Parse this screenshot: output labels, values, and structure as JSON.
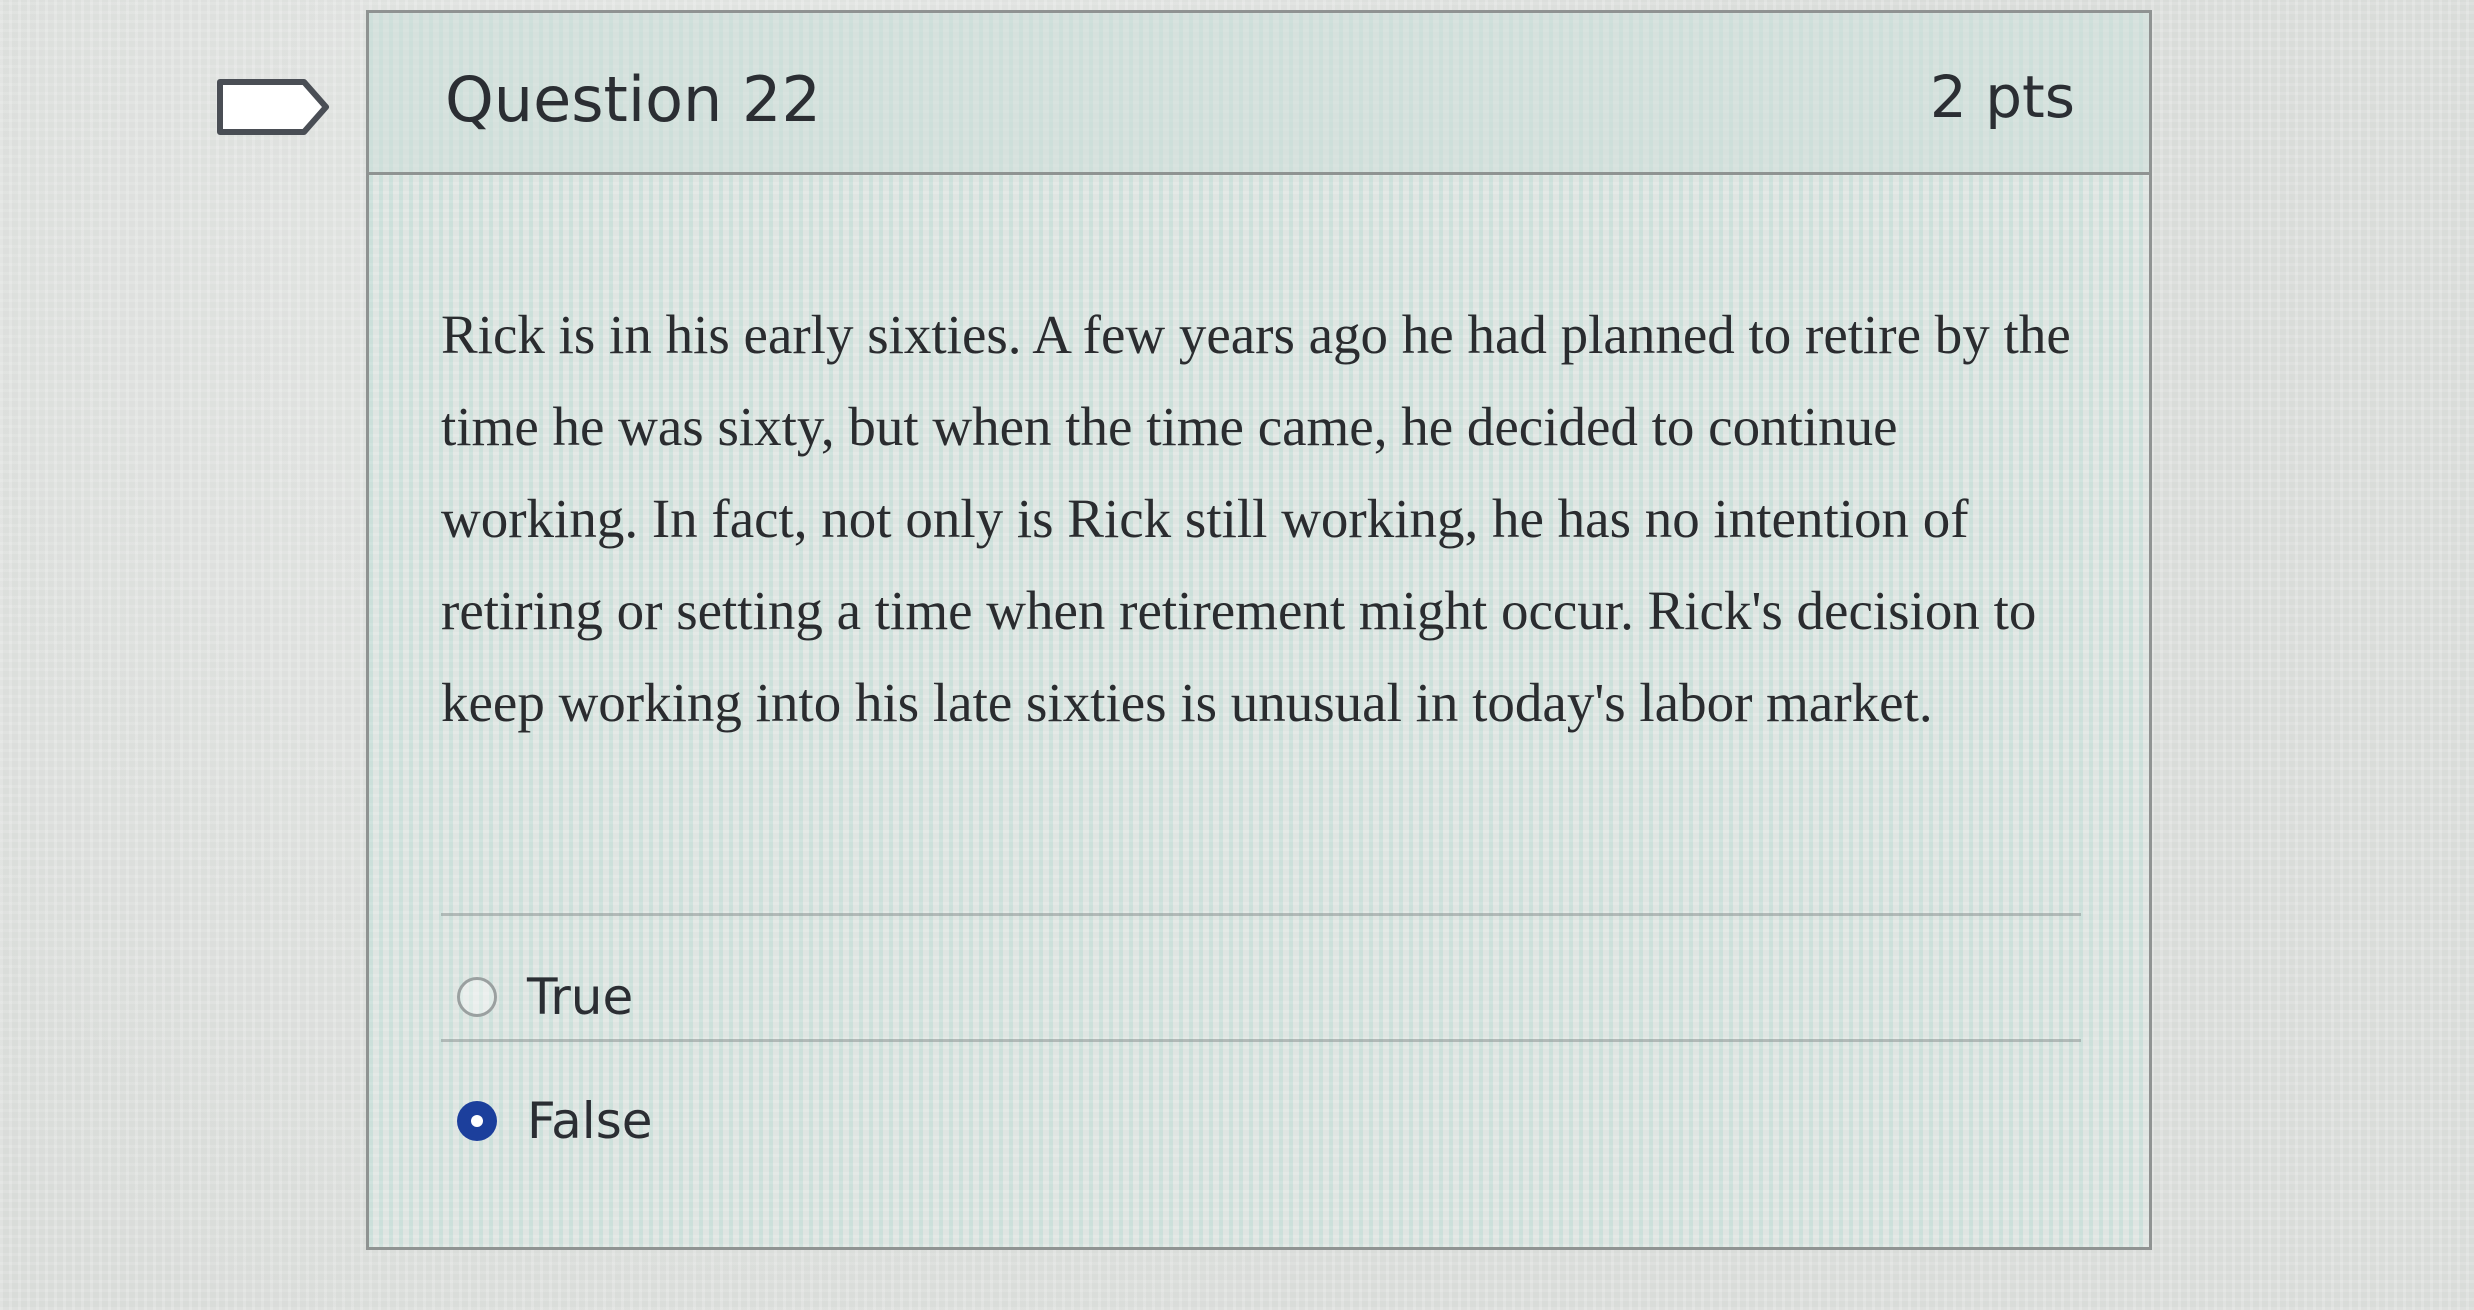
{
  "question": {
    "title": "Question 22",
    "points": "2 pts",
    "flag_icon": "flag-outline-icon",
    "text": "Rick is in his early sixties. A few years ago he had planned to retire by the time he was sixty, but when the time came, he decided to continue working. In fact, not only is Rick still working, he has no intention of retiring or setting a time when retirement might occur. Rick's decision to keep working into his late sixties is unusual in today's labor market."
  },
  "answers": [
    {
      "label": "True",
      "selected": false
    },
    {
      "label": "False",
      "selected": true
    }
  ],
  "colors": {
    "selected_radio": "#1c3f9c",
    "card_border": "#8f9392",
    "text": "#2b2e33"
  }
}
